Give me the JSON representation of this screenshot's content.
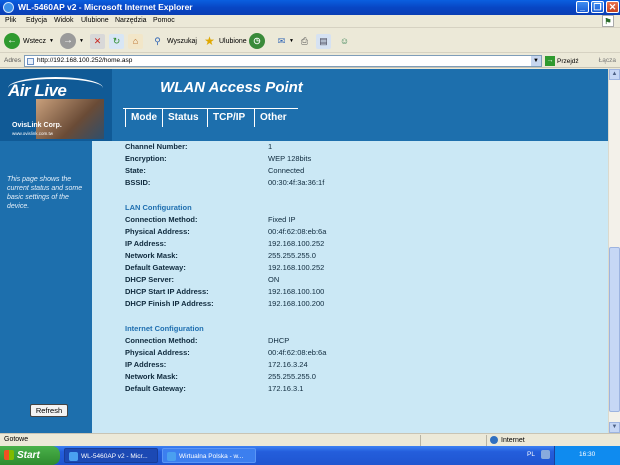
{
  "window": {
    "title": "WL-5460AP v2 - Microsoft Internet Explorer",
    "controls": [
      "_",
      "❐",
      "✕"
    ]
  },
  "menu": [
    "Plik",
    "Edycja",
    "Widok",
    "Ulubione",
    "Narzędzia",
    "Pomoc"
  ],
  "toolbar": {
    "back": "Wstecz",
    "search": "Wyszukaj",
    "favorites": "Ulubione"
  },
  "address": {
    "label": "Adres",
    "url": "http://192.168.100.252/home.asp",
    "go": "Przejdź",
    "links": "Łącza"
  },
  "header": {
    "logo": "Air Live",
    "company": "OvisLink Corp.",
    "company_url": "www.ovislink.com.tw",
    "title": "WLAN Access Point",
    "nav": [
      "Mode",
      "Status",
      "TCP/IP",
      "Other"
    ]
  },
  "sidebar": {
    "text": "This page shows the current status and some basic settings of the device."
  },
  "wireless": [
    {
      "label": "Channel Number:",
      "value": "1"
    },
    {
      "label": "Encryption:",
      "value": "WEP 128bits"
    },
    {
      "label": "State:",
      "value": "Connected"
    },
    {
      "label": "BSSID:",
      "value": "00:30:4f:3a:36:1f"
    }
  ],
  "lan": {
    "title": "LAN Configuration",
    "rows": [
      {
        "label": "Connection Method:",
        "value": "Fixed IP"
      },
      {
        "label": "Physical Address:",
        "value": "00:4f:62:08:eb:6a"
      },
      {
        "label": "IP Address:",
        "value": "192.168.100.252"
      },
      {
        "label": "Network Mask:",
        "value": "255.255.255.0"
      },
      {
        "label": "Default Gateway:",
        "value": "192.168.100.252"
      },
      {
        "label": "DHCP Server:",
        "value": "ON"
      },
      {
        "label": "DHCP Start IP Address:",
        "value": "192.168.100.100"
      },
      {
        "label": "DHCP Finish IP Address:",
        "value": "192.168.100.200"
      }
    ]
  },
  "internet": {
    "title": "Internet Configuration",
    "rows": [
      {
        "label": "Connection Method:",
        "value": "DHCP"
      },
      {
        "label": "Physical Address:",
        "value": "00:4f:62:08:eb:6a"
      },
      {
        "label": "IP Address:",
        "value": "172.16.3.24"
      },
      {
        "label": "Network Mask:",
        "value": "255.255.255.0"
      },
      {
        "label": "Default Gateway:",
        "value": "172.16.3.1"
      }
    ]
  },
  "refresh_label": "Refresh",
  "status": {
    "left": "Gotowe",
    "zone": "Internet"
  },
  "taskbar": {
    "start": "Start",
    "tasks": [
      "WL-5460AP v2 - Micr...",
      "Wirtualna Polska - w..."
    ],
    "lang": "PL",
    "clock": "16:30"
  }
}
